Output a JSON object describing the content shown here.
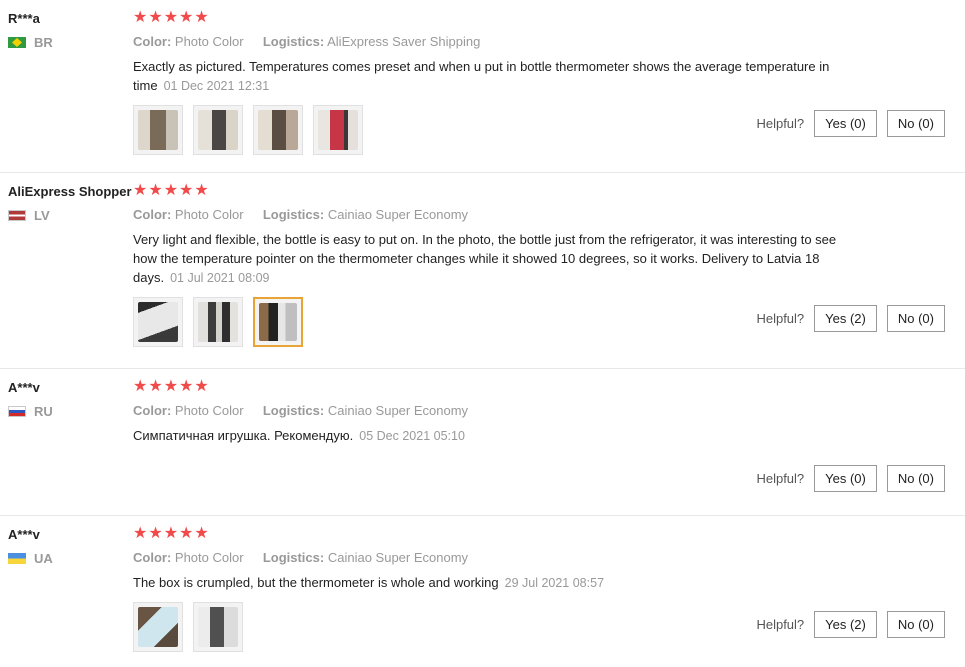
{
  "reviews": [
    {
      "user": "R***a",
      "country": "BR",
      "stars": "★★★★★",
      "color_label": "Color:",
      "color_value": "Photo Color",
      "logistics_label": "Logistics:",
      "logistics_value": "AliExpress Saver Shipping",
      "text": "Exactly as pictured. Temperatures comes preset and when u put in bottle thermometer shows the average temperature in time",
      "date": "01 Dec 2021 12:31",
      "helpful_label": "Helpful?",
      "yes_label": "Yes (0)",
      "no_label": "No (0)"
    },
    {
      "user": "AliExpress Shopper",
      "country": "LV",
      "stars": "★★★★★",
      "color_label": "Color:",
      "color_value": "Photo Color",
      "logistics_label": "Logistics:",
      "logistics_value": "Cainiao Super Economy",
      "text": "Very light and flexible, the bottle is easy to put on. In the photo, the bottle just from the refrigerator, it was interesting to see how the temperature pointer on the thermometer changes while it showed 10 degrees, so it works. Delivery to Latvia 18 days.",
      "date": "01 Jul 2021 08:09",
      "helpful_label": "Helpful?",
      "yes_label": "Yes (2)",
      "no_label": "No (0)"
    },
    {
      "user": "A***v",
      "country": "RU",
      "stars": "★★★★★",
      "color_label": "Color:",
      "color_value": "Photo Color",
      "logistics_label": "Logistics:",
      "logistics_value": "Cainiao Super Economy",
      "text": "Симпатичная игрушка. Рекомендую.",
      "date": "05 Dec 2021 05:10",
      "helpful_label": "Helpful?",
      "yes_label": "Yes (0)",
      "no_label": "No (0)"
    },
    {
      "user": "A***v",
      "country": "UA",
      "stars": "★★★★★",
      "color_label": "Color:",
      "color_value": "Photo Color",
      "logistics_label": "Logistics:",
      "logistics_value": "Cainiao Super Economy",
      "text": "The box is crumpled, but the thermometer is whole and working",
      "date": "29 Jul 2021 08:57",
      "helpful_label": "Helpful?",
      "yes_label": "Yes (2)",
      "no_label": "No (0)"
    }
  ],
  "colors": {
    "star": "#f04a4a",
    "muted": "#999999",
    "selected_thumb": "#e8a434"
  }
}
